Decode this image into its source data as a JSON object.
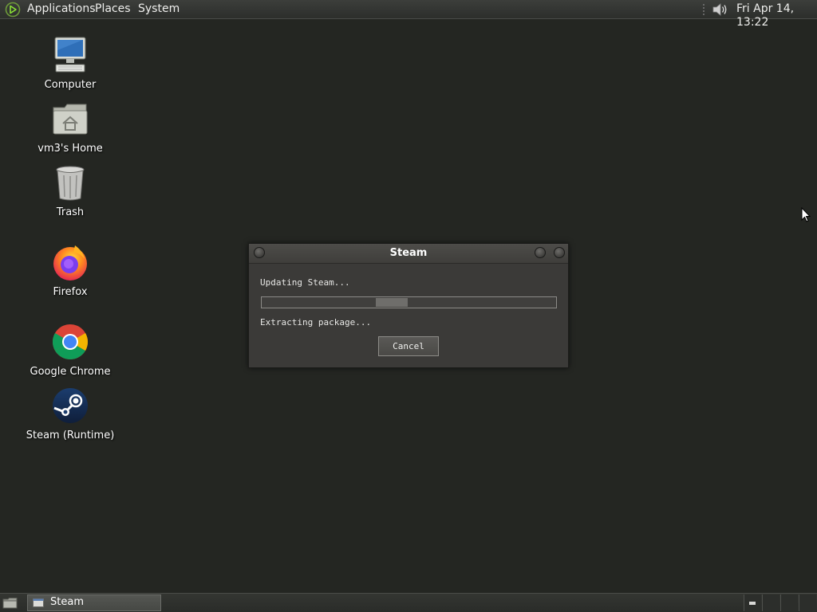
{
  "top_panel": {
    "menus": {
      "applications": "Applications",
      "places": "Places",
      "system": "System"
    },
    "clock": "Fri Apr 14, 13:22",
    "icons": [
      "gnome-foot-logo-icon",
      "volume-icon"
    ]
  },
  "desktop": {
    "icons": [
      {
        "label": "Computer",
        "icon": "computer-icon"
      },
      {
        "label": "vm3's Home",
        "icon": "home-folder-icon"
      },
      {
        "label": "Trash",
        "icon": "trash-icon"
      },
      {
        "label": "Firefox",
        "icon": "firefox-icon"
      },
      {
        "label": "Google Chrome",
        "icon": "chrome-icon"
      },
      {
        "label": "Steam (Runtime)",
        "icon": "steam-icon"
      }
    ]
  },
  "dialog": {
    "title": "Steam",
    "status": "Updating Steam...",
    "detail": "Extracting package...",
    "cancel_label": "Cancel",
    "progress_mode": "indeterminate"
  },
  "taskbar": {
    "items": [
      {
        "label": "Steam",
        "icon": "window-icon"
      }
    ],
    "workspaces": 4
  },
  "colors": {
    "desktop_bg": "#242622",
    "panel_bg": "#343632",
    "dialog_bg": "#3b3a38",
    "accent_green": "#8ae234"
  }
}
